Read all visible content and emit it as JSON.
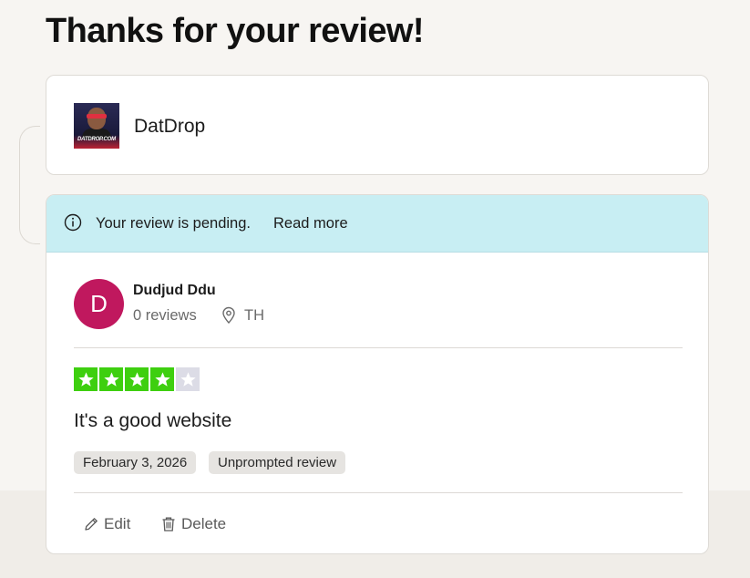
{
  "page": {
    "title": "Thanks for your review!"
  },
  "company": {
    "name": "DatDrop",
    "logo_text": "DATDROP.COM"
  },
  "banner": {
    "text": "Your review is pending.",
    "link": "Read more",
    "icon": "info-icon"
  },
  "reviewer": {
    "initial": "D",
    "name": "Dudjud Ddu",
    "review_count": "0 reviews",
    "country": "TH",
    "avatar_color": "#c0185e"
  },
  "review": {
    "rating": 4,
    "max_rating": 5,
    "star_color": "#3ecf0f",
    "empty_star_color": "#dcdce6",
    "title": "It's a good website",
    "date": "February 3, 2026",
    "tag": "Unprompted review"
  },
  "actions": {
    "edit": "Edit",
    "delete": "Delete"
  }
}
